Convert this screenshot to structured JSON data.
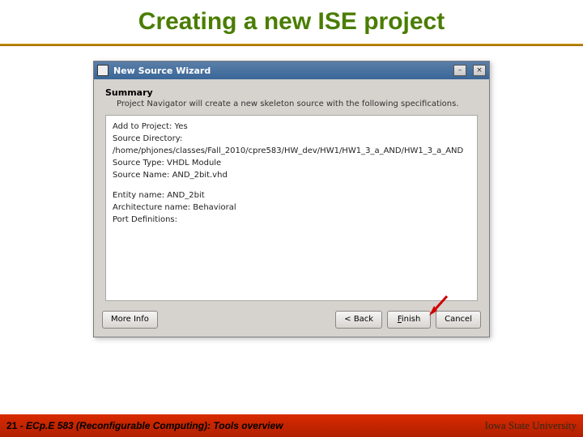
{
  "slide": {
    "title": "Creating a new ISE project"
  },
  "dialog": {
    "title": "New Source Wizard",
    "summary_header": "Summary",
    "summary_sub": "Project Navigator will create a new skeleton source with the following specifications.",
    "block1": {
      "l1": "Add to Project: Yes",
      "l2": "Source Directory:",
      "l3": "/home/phjones/classes/Fall_2010/cpre583/HW_dev/HW1/HW1_3_a_AND/HW1_3_a_AND",
      "l4": "Source Type: VHDL Module",
      "l5": "Source Name: AND_2bit.vhd"
    },
    "block2": {
      "l1": "Entity name: AND_2bit",
      "l2": "Architecture name: Behavioral",
      "l3": "Port Definitions:"
    },
    "buttons": {
      "more": "More Info",
      "back": "< Back",
      "finish": "Finish",
      "cancel": "Cancel"
    },
    "win_controls": {
      "min": "–",
      "close": "×"
    }
  },
  "footer": {
    "page": "21",
    "sep": " - ",
    "course": "ECp.E 583 (Reconfigurable Computing): Tools overview",
    "uni": "Iowa State University"
  }
}
